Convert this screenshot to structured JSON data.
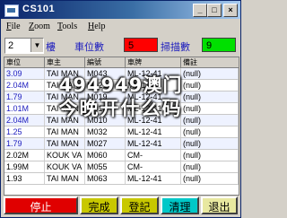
{
  "window": {
    "title": "CS101",
    "controls": {
      "minimize": "_",
      "maximize": "□",
      "close": "×"
    }
  },
  "menu": {
    "items": [
      {
        "mnemonic": "F",
        "rest": "ile"
      },
      {
        "mnemonic": "Z",
        "rest": "oom"
      },
      {
        "mnemonic": "T",
        "rest": "ools"
      },
      {
        "mnemonic": "H",
        "rest": "elp"
      }
    ]
  },
  "toolbar": {
    "select_value": "2",
    "select_suffix": "樓",
    "label_vehicles": "車位數",
    "count_vehicles": "5",
    "label_scan": "掃描數",
    "count_scan": "9",
    "colors": {
      "red": "#ff0000",
      "green": "#00e000"
    }
  },
  "table": {
    "columns": [
      "車位",
      "車主",
      "編號",
      "車牌",
      "備註"
    ],
    "rows": [
      [
        "3.09",
        "TAI MAN",
        "M043",
        "ML-12-41",
        "(null)"
      ],
      [
        "2.04M",
        "TAI MAN",
        "M021",
        "ML-12-41",
        "(null)"
      ],
      [
        "1.79",
        "TAI MAN",
        "M019",
        "ML-12-41",
        "(null)"
      ],
      [
        "1.01M",
        "TAI MAN",
        "M012",
        "ML-12-41",
        "(null)"
      ],
      [
        "2.04M",
        "TAI MAN",
        "M010",
        "ML-12-41",
        "(null)"
      ],
      [
        "1.25",
        "TAI MAN",
        "M032",
        "ML-12-41",
        "(null)"
      ],
      [
        "1.79",
        "TAI MAN",
        "M027",
        "ML-12-41",
        "(null)"
      ],
      [
        "2.02M",
        "KOUK VA",
        "M060",
        "CM-",
        "(null)"
      ],
      [
        "1.99M",
        "KOUK VA",
        "M055",
        "CM-",
        "(null)"
      ],
      [
        "1.93",
        "TAI MAN",
        "M063",
        "ML-12-41",
        "(null)"
      ]
    ]
  },
  "overlay": {
    "line1": "494949澳门",
    "line2": "今晚开什么码"
  },
  "buttons": {
    "stop": "停止",
    "done": "完成",
    "register": "登記",
    "clear": "清理",
    "exit": "退出",
    "colors": {
      "stop_bg": "#e00000",
      "done_bg": "#c8c800",
      "register_bg": "#c8c800",
      "clear_bg": "#00c8c8",
      "exit_bg": "#e8e8a0"
    }
  }
}
